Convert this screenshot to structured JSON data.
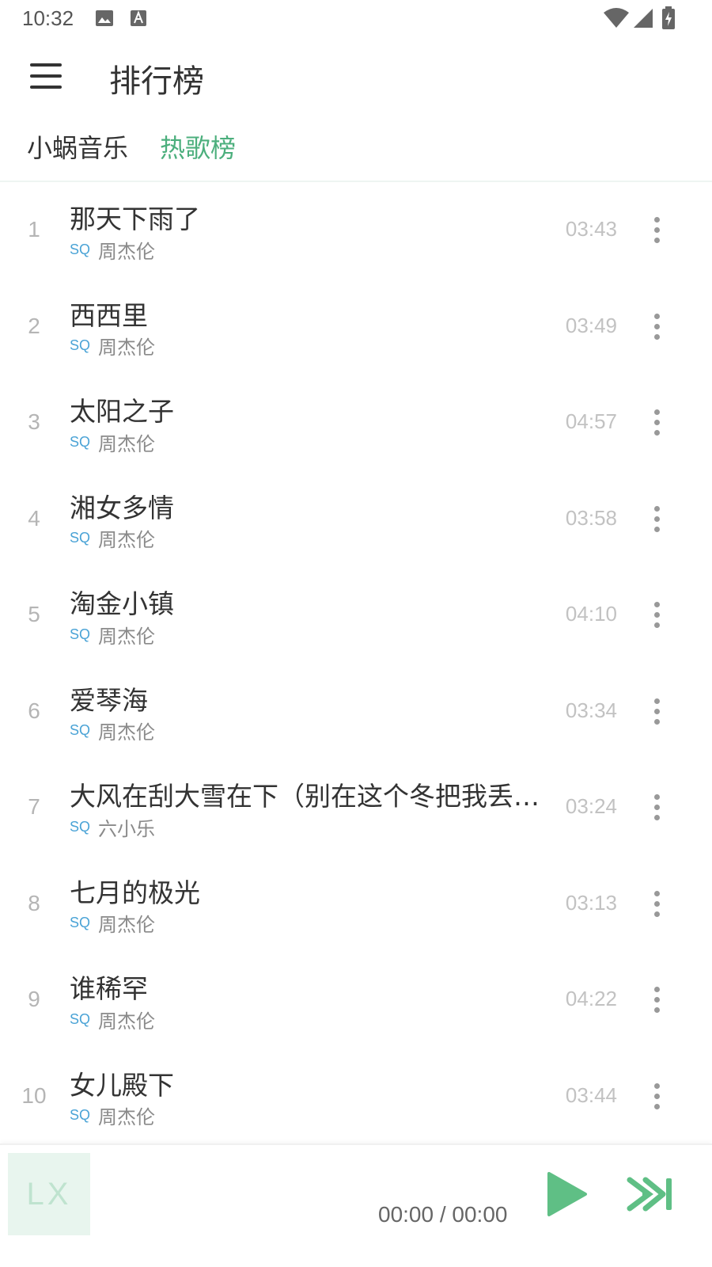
{
  "status_bar": {
    "time": "10:32",
    "icons": [
      "image-icon",
      "text-a-icon",
      "wifi-icon",
      "signal-icon",
      "battery-charging-icon"
    ]
  },
  "app_bar": {
    "menu_icon": "hamburger-menu-icon",
    "title": "排行榜"
  },
  "tabs": {
    "source": "小蜗音乐",
    "board": "热歌榜",
    "active_color": "#4caf7d"
  },
  "songs": [
    {
      "index": "1",
      "title": "那天下雨了",
      "quality": "SQ",
      "artist": "周杰伦",
      "duration": "03:43"
    },
    {
      "index": "2",
      "title": "西西里",
      "quality": "SQ",
      "artist": "周杰伦",
      "duration": "03:49"
    },
    {
      "index": "3",
      "title": "太阳之子",
      "quality": "SQ",
      "artist": "周杰伦",
      "duration": "04:57"
    },
    {
      "index": "4",
      "title": "湘女多情",
      "quality": "SQ",
      "artist": "周杰伦",
      "duration": "03:58"
    },
    {
      "index": "5",
      "title": "淘金小镇",
      "quality": "SQ",
      "artist": "周杰伦",
      "duration": "04:10"
    },
    {
      "index": "6",
      "title": "爱琴海",
      "quality": "SQ",
      "artist": "周杰伦",
      "duration": "03:34"
    },
    {
      "index": "7",
      "title": "大风在刮大雪在下（别在这个冬把我丢下...",
      "quality": "SQ",
      "artist": "六小乐",
      "duration": "03:24"
    },
    {
      "index": "8",
      "title": "七月的极光",
      "quality": "SQ",
      "artist": "周杰伦",
      "duration": "03:13"
    },
    {
      "index": "9",
      "title": "谁稀罕",
      "quality": "SQ",
      "artist": "周杰伦",
      "duration": "04:22"
    },
    {
      "index": "10",
      "title": "女儿殿下",
      "quality": "SQ",
      "artist": "周杰伦",
      "duration": "03:44"
    }
  ],
  "player": {
    "cover_text": "LX",
    "time": "00:00 / 00:00",
    "play_icon": "play-icon",
    "next_icon": "skip-next-icon",
    "accent_color": "#5fbf85"
  }
}
